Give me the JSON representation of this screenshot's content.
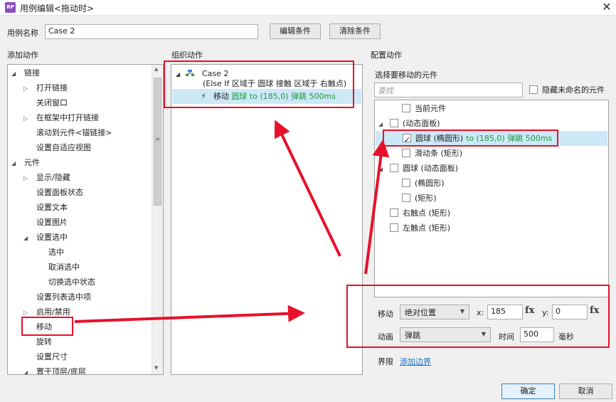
{
  "window": {
    "title": "用例编辑<拖动时>",
    "app_icon": "RP",
    "close": "✕"
  },
  "case_name": {
    "label": "用例名称",
    "value": "Case 2",
    "edit_condition": "编辑条件",
    "clear_condition": "清除条件"
  },
  "add_actions": {
    "header": "添加动作",
    "items": [
      {
        "label": "链接",
        "level": 0,
        "toggle": "open"
      },
      {
        "label": "打开链接",
        "level": 1,
        "toggle": "closed"
      },
      {
        "label": "关闭窗口",
        "level": 1,
        "toggle": "none"
      },
      {
        "label": "在框架中打开链接",
        "level": 1,
        "toggle": "closed"
      },
      {
        "label": "滚动到元件<锚链接>",
        "level": 1,
        "toggle": "none"
      },
      {
        "label": "设置自适应视图",
        "level": 1,
        "toggle": "none"
      },
      {
        "label": "元件",
        "level": 0,
        "toggle": "open"
      },
      {
        "label": "显示/隐藏",
        "level": 1,
        "toggle": "closed"
      },
      {
        "label": "设置面板状态",
        "level": 1,
        "toggle": "none"
      },
      {
        "label": "设置文本",
        "level": 1,
        "toggle": "none"
      },
      {
        "label": "设置图片",
        "level": 1,
        "toggle": "none"
      },
      {
        "label": "设置选中",
        "level": 1,
        "toggle": "open"
      },
      {
        "label": "选中",
        "level": 2,
        "toggle": "none"
      },
      {
        "label": "取消选中",
        "level": 2,
        "toggle": "none"
      },
      {
        "label": "切换选中状态",
        "level": 2,
        "toggle": "none"
      },
      {
        "label": "设置列表选中项",
        "level": 1,
        "toggle": "none"
      },
      {
        "label": "启用/禁用",
        "level": 1,
        "toggle": "closed"
      },
      {
        "label": "移动",
        "level": 1,
        "toggle": "none"
      },
      {
        "label": "旋转",
        "level": 1,
        "toggle": "none"
      },
      {
        "label": "设置尺寸",
        "level": 1,
        "toggle": "none"
      },
      {
        "label": "置于顶层/底层",
        "level": 1,
        "toggle": "open"
      }
    ]
  },
  "organize": {
    "header": "组织动作",
    "case_title": "Case 2",
    "case_condition": "(Else If 区域于 圆球 接触 区域于 右触点)",
    "action_prefix": "移动",
    "action_detail": "圆球 to (185,0) 弹跳 500ms"
  },
  "configure": {
    "header": "配置动作",
    "select_label": "选择要移动的元件",
    "search_placeholder": "查找",
    "hide_unnamed": "隐藏未命名的元件",
    "tree": [
      {
        "label": "当前元件",
        "level": 1,
        "toggle": "none",
        "checked": false,
        "detail": ""
      },
      {
        "label": "(动态面板)",
        "level": 0,
        "toggle": "open",
        "checked": false,
        "detail": ""
      },
      {
        "label": "圆球 (椭圆形)",
        "level": 1,
        "toggle": "none",
        "checked": true,
        "detail": "to (185,0) 弹跳 500ms"
      },
      {
        "label": "滑动条 (矩形)",
        "level": 1,
        "toggle": "none",
        "checked": false,
        "detail": ""
      },
      {
        "label": "圆球 (动态面板)",
        "level": 0,
        "toggle": "open",
        "checked": false,
        "detail": ""
      },
      {
        "label": "(椭圆形)",
        "level": 1,
        "toggle": "none",
        "checked": false,
        "detail": ""
      },
      {
        "label": "(矩形)",
        "level": 1,
        "toggle": "none",
        "checked": false,
        "detail": ""
      },
      {
        "label": "右触点 (矩形)",
        "level": 0,
        "toggle": "none",
        "checked": false,
        "detail": ""
      },
      {
        "label": "左触点 (矩形)",
        "level": 0,
        "toggle": "none",
        "checked": false,
        "detail": ""
      }
    ],
    "move_label": "移动",
    "move_type": "绝对位置",
    "x_label": "x:",
    "x_value": "185",
    "y_label": "y:",
    "y_value": "0",
    "fx": "fx",
    "anim_label": "动画",
    "anim_value": "弹跳",
    "time_label": "时间",
    "time_value": "500",
    "time_unit": "毫秒",
    "bounds_label": "界限",
    "bounds_link": "添加边界"
  },
  "footer": {
    "ok": "确定",
    "cancel": "取消"
  },
  "colors": {
    "highlight_red": "#e8102a",
    "selection_blue": "#cde8f7",
    "green_text": "#1a9a3c",
    "link": "#1a73c7"
  }
}
